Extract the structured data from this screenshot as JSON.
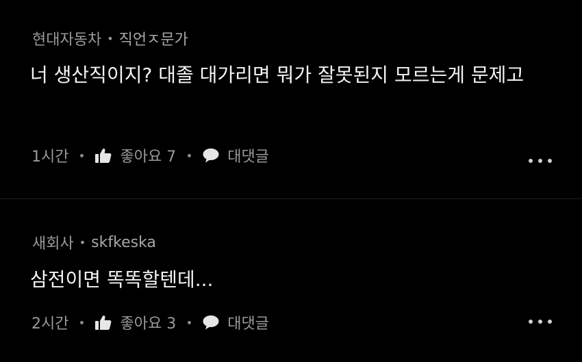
{
  "comments": [
    {
      "company": "현대자동차",
      "author": "직언ㅈ문가",
      "text": "너 생산직이지? 대졸 대가리면 뭐가 잘못된지 모르는게 문제고",
      "time": "1시간",
      "like_label": "좋아요 7",
      "reply_label": "대댓글"
    },
    {
      "company": "새회사",
      "author": "skfkeska",
      "text": "삼전이면 똑똑할텐데...",
      "time": "2시간",
      "like_label": "좋아요 3",
      "reply_label": "대댓글"
    }
  ],
  "icons": {
    "like": "thumbs-up-icon",
    "reply": "speech-bubble-icon",
    "more": "more-dots-icon"
  },
  "colors": {
    "background": "#000000",
    "text": "#f4f4f4",
    "muted": "#9a9a9a"
  }
}
